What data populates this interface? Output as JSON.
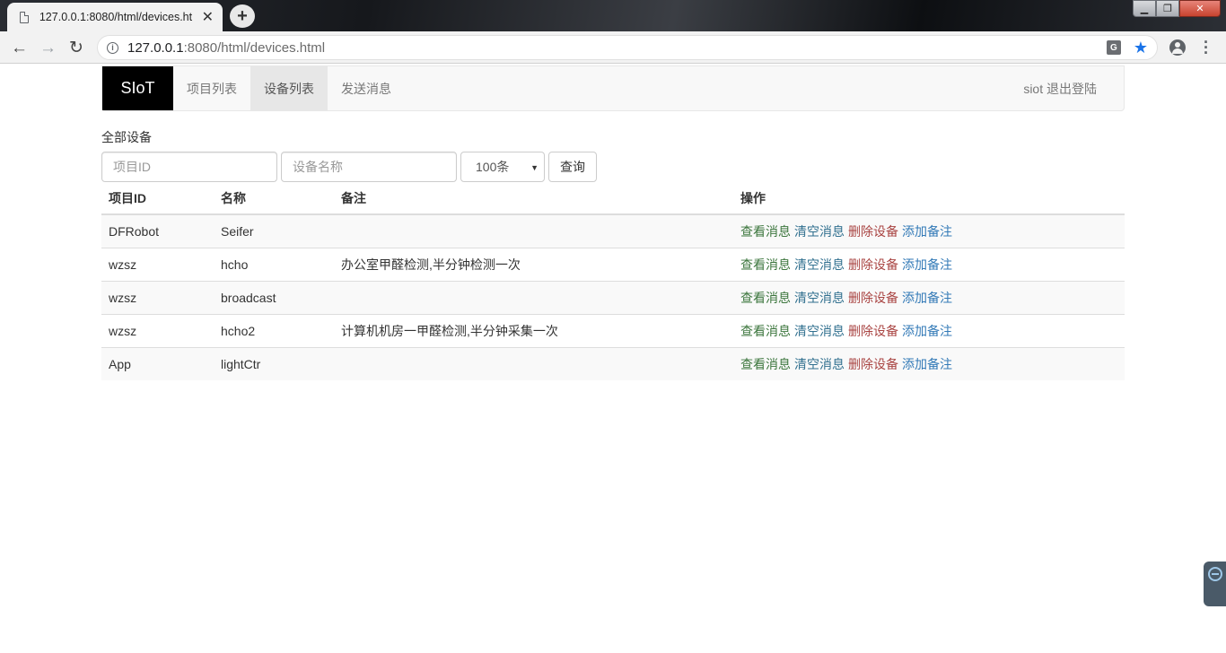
{
  "browser": {
    "tab_title": "127.0.0.1:8080/html/devices.ht",
    "tab_close": "✕",
    "new_tab": "+",
    "url_host": "127.0.0.1",
    "url_rest": ":8080/html/devices.html",
    "translate_icon_text": "G",
    "window_buttons": {
      "minimize": "▁",
      "maximize": "❐",
      "close": "✕"
    }
  },
  "navbar": {
    "brand": "SIoT",
    "items": [
      {
        "label": "项目列表",
        "active": false
      },
      {
        "label": "设备列表",
        "active": true
      },
      {
        "label": "发送消息",
        "active": false
      }
    ],
    "user": "siot 退出登陆"
  },
  "filters": {
    "section_title": "全部设备",
    "project_id_placeholder": "项目ID",
    "device_name_placeholder": "设备名称",
    "limit_selected": "100条",
    "query_button": "查询"
  },
  "table": {
    "headers": {
      "project_id": "项目ID",
      "name": "名称",
      "note": "备注",
      "actions": "操作"
    },
    "actions": {
      "view": "查看消息",
      "clear": "清空消息",
      "delete": "删除设备",
      "add_note": "添加备注"
    },
    "rows": [
      {
        "project_id": "DFRobot",
        "name": "Seifer",
        "note": ""
      },
      {
        "project_id": "wzsz",
        "name": "hcho",
        "note": "办公室甲醛检测,半分钟检测一次"
      },
      {
        "project_id": "wzsz",
        "name": "broadcast",
        "note": ""
      },
      {
        "project_id": "wzsz",
        "name": "hcho2",
        "note": "计算机机房一甲醛检测,半分钟采集一次"
      },
      {
        "project_id": "App",
        "name": "lightCtr",
        "note": ""
      }
    ]
  },
  "colors": {
    "view": "#3c763d",
    "clear": "#31708f",
    "delete": "#a94442",
    "add_note": "#337ab7",
    "brand_bg": "#000000"
  }
}
